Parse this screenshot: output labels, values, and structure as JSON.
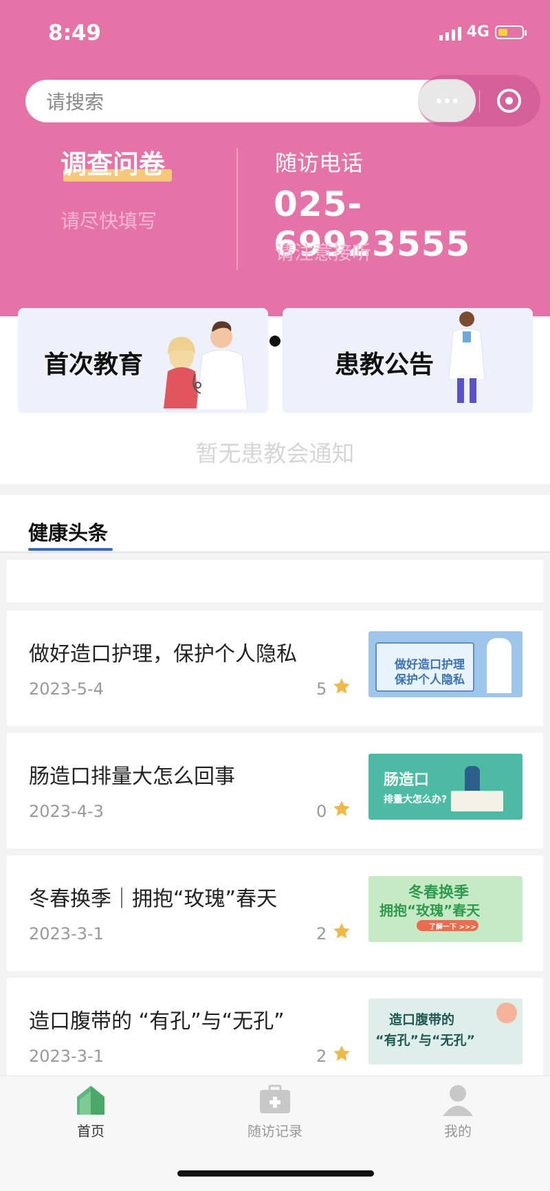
{
  "status_bar": {
    "time": "8:49",
    "network": "4G"
  },
  "search": {
    "placeholder": "请搜索"
  },
  "survey": {
    "title": "调查问卷",
    "subtitle": "请尽快填写"
  },
  "phone": {
    "label": "随访电话",
    "number": "025-69923555",
    "subtitle": "请注意接听"
  },
  "cards": [
    {
      "label": "首次教育"
    },
    {
      "label": "患教公告"
    }
  ],
  "notice": "暂无患教会通知",
  "section_tab": "健康头条",
  "news": [
    {
      "title": "做好造口护理，保护个人隐私",
      "date": "2023-5-4",
      "count": "5",
      "thumb_lines": [
        "做好造口护理",
        "保护个人隐私"
      ]
    },
    {
      "title": "肠造口排量大怎么回事",
      "date": "2023-4-3",
      "count": "0",
      "thumb_lines": [
        "肠造口",
        "排量大怎么办?"
      ]
    },
    {
      "title": "冬春换季｜拥抱“玫瑰”春天",
      "date": "2023-3-1",
      "count": "2",
      "thumb_lines": [
        "冬春换季",
        "拥抱“玫瑰”春天",
        "了解一下 >>>"
      ]
    },
    {
      "title": "造口腹带的 “有孔”与“无孔”",
      "date": "2023-3-1",
      "count": "2",
      "thumb_lines": [
        "造口腹带的",
        "“有孔”与“无孔”"
      ]
    }
  ],
  "tabbar": [
    {
      "label": "首页",
      "icon": "home-icon"
    },
    {
      "label": "随访记录",
      "icon": "medical-kit-icon"
    },
    {
      "label": "我的",
      "icon": "user-icon"
    }
  ],
  "colors": {
    "header_pink": "#e673a8",
    "tab_underline": "#3a66c9",
    "home_green": "#5cb87a"
  }
}
